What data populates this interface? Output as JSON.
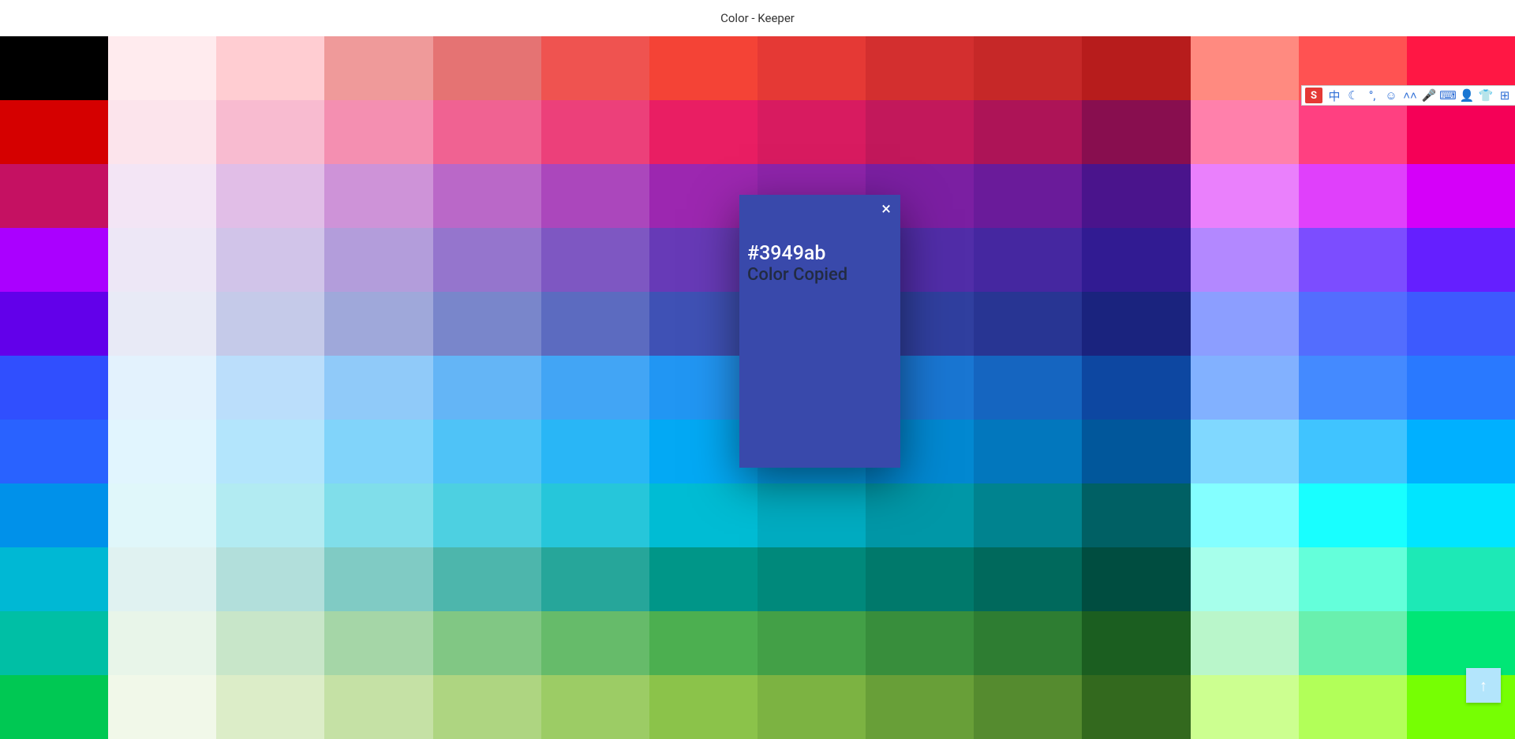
{
  "header": {
    "title": "Color - Keeper"
  },
  "palette_rows": [
    [
      "#000000",
      "#ffebee",
      "#ffcdd2",
      "#ef9a9a",
      "#e57373",
      "#ef5350",
      "#f44336",
      "#e53935",
      "#d32f2f",
      "#c62828",
      "#b71c1c",
      "#ff8a80",
      "#ff5252",
      "#ff1744"
    ],
    [
      "#d50000",
      "#fce4ec",
      "#f8bbd0",
      "#f48fb1",
      "#f06292",
      "#ec407a",
      "#e91e63",
      "#d81b60",
      "#c2185b",
      "#ad1457",
      "#880e4f",
      "#ff80ab",
      "#ff4081",
      "#f50057"
    ],
    [
      "#c51162",
      "#f3e5f5",
      "#e1bee7",
      "#ce93d8",
      "#ba68c8",
      "#ab47bc",
      "#9c27b0",
      "#8e24aa",
      "#7b1fa2",
      "#6a1b9a",
      "#4a148c",
      "#ea80fc",
      "#e040fb",
      "#d500f9"
    ],
    [
      "#aa00ff",
      "#ede7f6",
      "#d1c4e9",
      "#b39ddb",
      "#9575cd",
      "#7e57c2",
      "#673ab7",
      "#5e35b1",
      "#512da8",
      "#4527a0",
      "#311b92",
      "#b388ff",
      "#7c4dff",
      "#651fff"
    ],
    [
      "#6200ea",
      "#e8eaf6",
      "#c5cae9",
      "#9fa8da",
      "#7986cb",
      "#5c6bc0",
      "#3f51b5",
      "#3949ab",
      "#303f9f",
      "#283593",
      "#1a237e",
      "#8c9eff",
      "#536dfe",
      "#3d5afe"
    ],
    [
      "#304ffe",
      "#e3f2fd",
      "#bbdefb",
      "#90caf9",
      "#64b5f6",
      "#42a5f5",
      "#2196f3",
      "#1e88e5",
      "#1976d2",
      "#1565c0",
      "#0d47a1",
      "#82b1ff",
      "#448aff",
      "#2979ff"
    ],
    [
      "#2962ff",
      "#e1f5fe",
      "#b3e5fc",
      "#81d4fa",
      "#4fc3f7",
      "#29b6f6",
      "#03a9f4",
      "#039be5",
      "#0288d1",
      "#0277bd",
      "#01579b",
      "#80d8ff",
      "#40c4ff",
      "#00b0ff"
    ],
    [
      "#0091ea",
      "#e0f7fa",
      "#b2ebf2",
      "#80deea",
      "#4dd0e1",
      "#26c6da",
      "#00bcd4",
      "#00acc1",
      "#0097a7",
      "#00838f",
      "#006064",
      "#84ffff",
      "#18ffff",
      "#00e5ff"
    ],
    [
      "#00b8d4",
      "#e0f2f1",
      "#b2dfdb",
      "#80cbc4",
      "#4db6ac",
      "#26a69a",
      "#009688",
      "#00897b",
      "#00796b",
      "#00695c",
      "#004d40",
      "#a7ffeb",
      "#64ffda",
      "#1de9b6"
    ],
    [
      "#00bfa5",
      "#e8f5e9",
      "#c8e6c9",
      "#a5d6a7",
      "#81c784",
      "#66bb6a",
      "#4caf50",
      "#43a047",
      "#388e3c",
      "#2e7d32",
      "#1b5e20",
      "#b9f6ca",
      "#69f0ae",
      "#00e676"
    ],
    [
      "#00c853",
      "#f1f8e9",
      "#dcedc8",
      "#c5e1a5",
      "#aed581",
      "#9ccc65",
      "#8bc34a",
      "#7cb342",
      "#689f38",
      "#558b2f",
      "#33691e",
      "#ccff90",
      "#b2ff59",
      "#76ff03"
    ]
  ],
  "popup": {
    "hex": "#3949ab",
    "message": "Color Copied",
    "close": "×",
    "bg": "#3949ab"
  },
  "ime": {
    "logo": "S",
    "items": [
      "中",
      "☾",
      "°,",
      "☺",
      "˄˄",
      "🎤",
      "⌨",
      "👤",
      "👕",
      "⊞"
    ]
  },
  "scroll_top": {
    "label": "↑"
  }
}
